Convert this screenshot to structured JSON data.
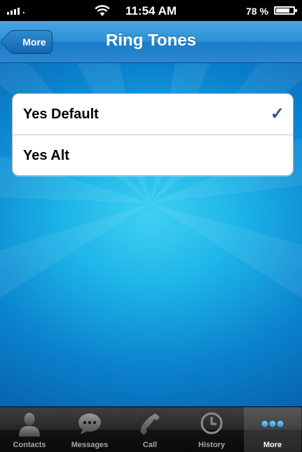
{
  "status_bar": {
    "time": "11:54 AM",
    "battery_percent": "78 %",
    "battery_level": 0.78
  },
  "nav": {
    "back_label": "More",
    "title": "Ring Tones"
  },
  "ringtones": [
    {
      "label": "Yes Default",
      "selected": true
    },
    {
      "label": "Yes Alt",
      "selected": false
    }
  ],
  "checkmark_glyph": "✓",
  "tabs": [
    {
      "label": "Contacts",
      "icon": "contacts-icon",
      "active": false
    },
    {
      "label": "Messages",
      "icon": "messages-icon",
      "active": false
    },
    {
      "label": "Call",
      "icon": "phone-icon",
      "active": false
    },
    {
      "label": "History",
      "icon": "clock-icon",
      "active": false
    },
    {
      "label": "More",
      "icon": "more-dots-icon",
      "active": true
    }
  ],
  "colors": {
    "nav_blue": "#2a8fd6",
    "check_color": "#385487",
    "background_cyan": "#1db4e8"
  }
}
